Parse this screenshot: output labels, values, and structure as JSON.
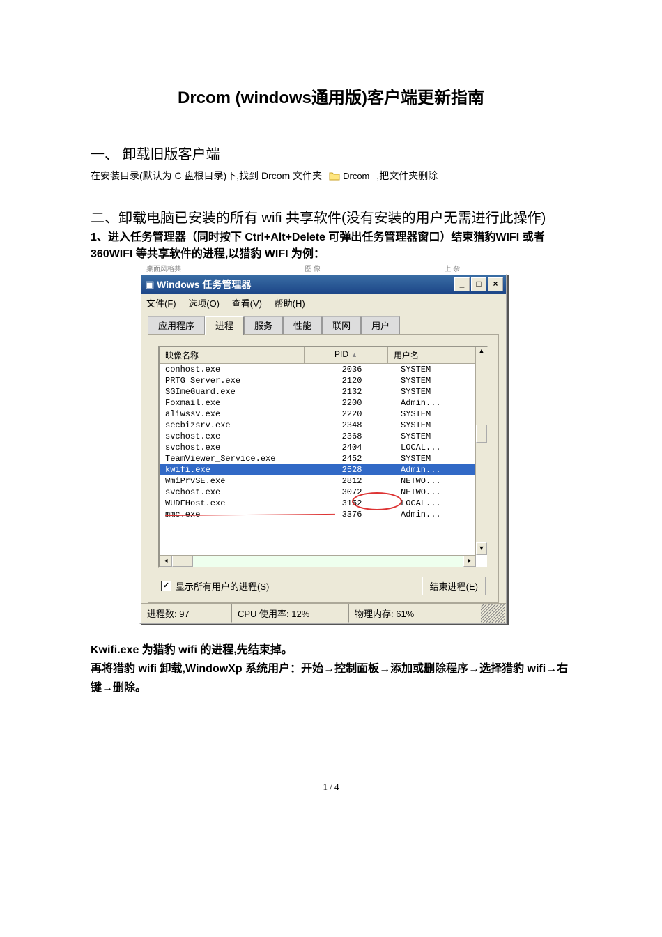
{
  "doc": {
    "title": "Drcom (windows通用版)客户端更新指南",
    "section1_h": "一、  卸载旧版客户端",
    "section1_p1": "在安装目录(默认为 C 盘根目录)下,找到 Drcom 文件夹",
    "section1_p2": " ,把文件夹删除",
    "folder_label": "Drcom",
    "section2_h": "二、卸载电脑已安装的所有 wifi 共享软件(没有安装的用户无需进行此操作)",
    "instr1": "1、进入任务管理器（同时按下 Ctrl+Alt+Delete 可弹出任务管理器窗口）结束猎豹WIFI 或者 360WIFI 等共享软件的进程,以猎豹 WIFI 为例：",
    "post1": "   Kwifi.exe 为猎豹 wifi 的进程,先结束掉。",
    "post2": "  再将猎豹 wifi 卸载,WindowXp 系统用户：开始→控制面板→添加或删除程序→选择猎豹 wifi→右键→删除。",
    "pagenum": "1 / 4"
  },
  "tmtop": {
    "left": "桌面风格共",
    "mid": "图 像",
    "right": "上 杂"
  },
  "tm": {
    "title": "Windows 任务管理器",
    "menu": {
      "file": "文件(F)",
      "opt": "选项(O)",
      "view": "查看(V)",
      "help": "帮助(H)"
    },
    "tabs": {
      "app": "应用程序",
      "proc": "进程",
      "svc": "服务",
      "perf": "性能",
      "net": "联网",
      "user": "用户"
    },
    "head": {
      "name": "映像名称",
      "pid": "PID",
      "user": "用户名"
    },
    "rows": [
      {
        "n": "conhost.exe",
        "p": "2036",
        "u": "SYSTEM"
      },
      {
        "n": "PRTG Server.exe",
        "p": "2120",
        "u": "SYSTEM"
      },
      {
        "n": "SGImeGuard.exe",
        "p": "2132",
        "u": "SYSTEM"
      },
      {
        "n": "Foxmail.exe",
        "p": "2200",
        "u": "Admin..."
      },
      {
        "n": "aliwssv.exe",
        "p": "2220",
        "u": "SYSTEM"
      },
      {
        "n": "secbizsrv.exe",
        "p": "2348",
        "u": "SYSTEM"
      },
      {
        "n": "svchost.exe",
        "p": "2368",
        "u": "SYSTEM"
      },
      {
        "n": "svchost.exe",
        "p": "2404",
        "u": "LOCAL..."
      },
      {
        "n": "TeamViewer_Service.exe",
        "p": "2452",
        "u": "SYSTEM"
      },
      {
        "n": "kwifi.exe",
        "p": "2528",
        "u": "Admin...",
        "sel": true
      },
      {
        "n": "WmiPrvSE.exe",
        "p": "2812",
        "u": "NETWO..."
      },
      {
        "n": "svchost.exe",
        "p": "3072",
        "u": "NETWO..."
      },
      {
        "n": "WUDFHost.exe",
        "p": "3152",
        "u": "LOCAL..."
      },
      {
        "n": "mmc.exe",
        "p": "3376",
        "u": "Admin..."
      }
    ],
    "show_all": "显示所有用户的进程(S)",
    "end_btn": "结束进程(E)",
    "status": {
      "procs": "进程数: 97",
      "cpu": "CPU 使用率: 12%",
      "mem": "物理内存: 61%"
    }
  }
}
